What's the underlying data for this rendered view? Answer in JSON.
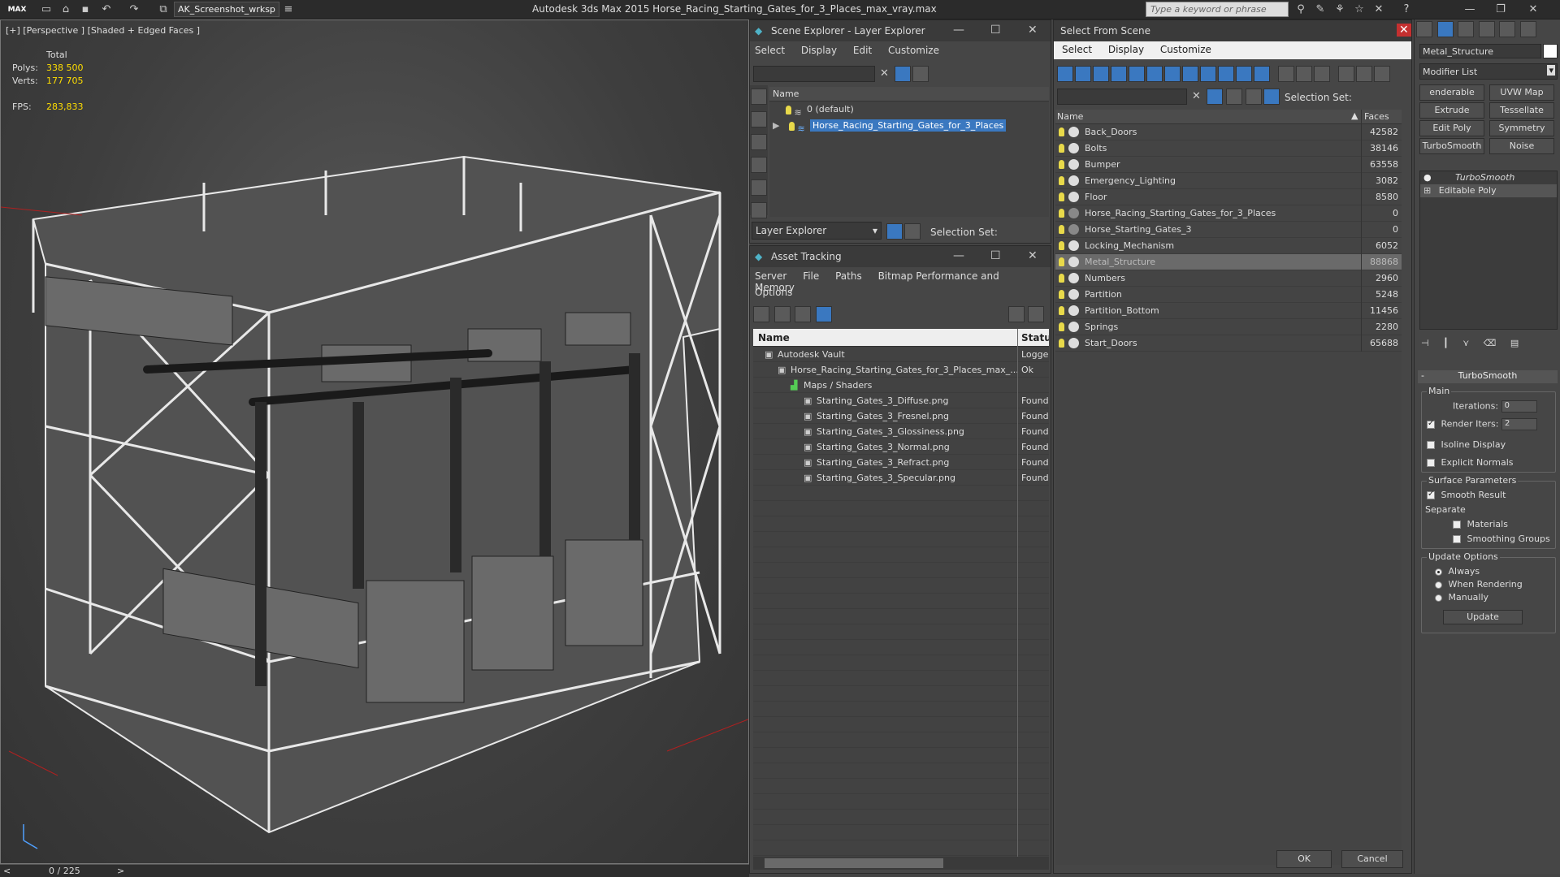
{
  "titlebar": {
    "logo": "MAX",
    "workspace": "AK_Screenshot_wrksp",
    "app_title": "Autodesk 3ds Max  2015     Horse_Racing_Starting_Gates_for_3_Places_max_vray.max",
    "search_placeholder": "Type a keyword or phrase"
  },
  "viewport": {
    "label": "[+] [Perspective ] [Shaded + Edged Faces ]",
    "stats_header": "Total",
    "polys_label": "Polys:",
    "polys_value": "338 500",
    "verts_label": "Verts:",
    "verts_value": "177 705",
    "fps_label": "FPS:",
    "fps_value": "283,833"
  },
  "timeline": {
    "frame": "0 / 225",
    "prev": "<",
    "next": ">"
  },
  "scene_explorer": {
    "title": "Scene Explorer - Layer Explorer",
    "menu": [
      "Select",
      "Display",
      "Edit",
      "Customize"
    ],
    "column": "Name",
    "layers": [
      {
        "name": "0 (default)",
        "selected": false
      },
      {
        "name": "Horse_Racing_Starting_Gates_for_3_Places",
        "selected": true
      }
    ],
    "footer_dropdown": "Layer Explorer",
    "selection_set_label": "Selection Set:"
  },
  "asset_tracking": {
    "title": "Asset Tracking",
    "menu": [
      "Server",
      "File",
      "Paths",
      "Bitmap Performance and Memory"
    ],
    "menu2": "Options",
    "col_name": "Name",
    "col_status": "Status",
    "rows": [
      {
        "name": "Autodesk Vault",
        "status": "Logge",
        "indent": 1
      },
      {
        "name": "Horse_Racing_Starting_Gates_for_3_Places_max_...",
        "status": "Ok",
        "indent": 2
      },
      {
        "name": "Maps / Shaders",
        "status": "",
        "indent": 3
      },
      {
        "name": "Starting_Gates_3_Diffuse.png",
        "status": "Found",
        "indent": 4
      },
      {
        "name": "Starting_Gates_3_Fresnel.png",
        "status": "Found",
        "indent": 4
      },
      {
        "name": "Starting_Gates_3_Glossiness.png",
        "status": "Found",
        "indent": 4
      },
      {
        "name": "Starting_Gates_3_Normal.png",
        "status": "Found",
        "indent": 4
      },
      {
        "name": "Starting_Gates_3_Refract.png",
        "status": "Found",
        "indent": 4
      },
      {
        "name": "Starting_Gates_3_Specular.png",
        "status": "Found",
        "indent": 4
      }
    ]
  },
  "select_from_scene": {
    "title": "Select From Scene",
    "menu": [
      "Select",
      "Display",
      "Customize"
    ],
    "selection_set_label": "Selection Set:",
    "col_name": "Name",
    "col_faces": "Faces",
    "rows": [
      {
        "name": "Back_Doors",
        "faces": "42582",
        "selected": false
      },
      {
        "name": "Bolts",
        "faces": "38146",
        "selected": false
      },
      {
        "name": "Bumper",
        "faces": "63558",
        "selected": false
      },
      {
        "name": "Emergency_Lighting",
        "faces": "3082",
        "selected": false
      },
      {
        "name": "Floor",
        "faces": "8580",
        "selected": false
      },
      {
        "name": "Horse_Racing_Starting_Gates_for_3_Places",
        "faces": "0",
        "selected": false
      },
      {
        "name": "Horse_Starting_Gates_3",
        "faces": "0",
        "selected": false
      },
      {
        "name": "Locking_Mechanism",
        "faces": "6052",
        "selected": false
      },
      {
        "name": "Metal_Structure",
        "faces": "88868",
        "selected": true
      },
      {
        "name": "Numbers",
        "faces": "2960",
        "selected": false
      },
      {
        "name": "Partition",
        "faces": "5248",
        "selected": false
      },
      {
        "name": "Partition_Bottom",
        "faces": "11456",
        "selected": false
      },
      {
        "name": "Springs",
        "faces": "2280",
        "selected": false
      },
      {
        "name": "Start_Doors",
        "faces": "65688",
        "selected": false
      }
    ],
    "ok": "OK",
    "cancel": "Cancel"
  },
  "modifier_panel": {
    "object_name": "Metal_Structure",
    "modifier_list": "Modifier List",
    "buttons": [
      "enderable Spli",
      "UVW Map",
      "Extrude",
      "Tessellate",
      "Edit Poly",
      "Symmetry",
      "TurboSmooth",
      "Noise"
    ],
    "stack": [
      "TurboSmooth",
      "Editable Poly"
    ],
    "rollout_title": "TurboSmooth",
    "main_label": "Main",
    "iterations_label": "Iterations:",
    "iterations_value": "0",
    "render_iters_label": "Render Iters:",
    "render_iters_value": "2",
    "isoline": "Isoline Display",
    "explicit_normals": "Explicit Normals",
    "surface_params": "Surface Parameters",
    "smooth_result": "Smooth Result",
    "separate": "Separate",
    "materials": "Materials",
    "smoothing_groups": "Smoothing Groups",
    "update_options": "Update Options",
    "always": "Always",
    "when_rendering": "When Rendering",
    "manually": "Manually",
    "update_btn": "Update"
  }
}
